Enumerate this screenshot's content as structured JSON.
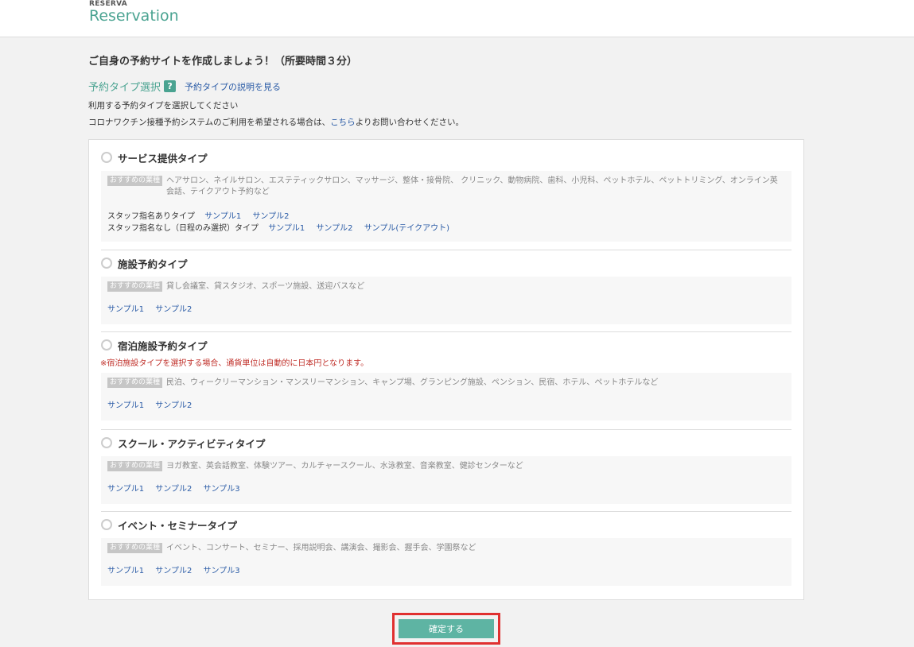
{
  "header": {
    "brand_small": "RESERVA",
    "brand_big": "Reservation"
  },
  "page": {
    "title": "ご自身の予約サイトを作成しましょう！（所要時間３分）",
    "section_title": "予約タイプ選択",
    "help_icon": "?",
    "help_link": "予約タイプの説明を見る",
    "intro1": "利用する予約タイプを選択してください",
    "intro2_before": "コロナワクチン接種予約システムのご利用を希望される場合は、",
    "intro2_link": "こちら",
    "intro2_after": "よりお問い合わせください。"
  },
  "badge_label": "おすすめの業種",
  "types": [
    {
      "name": "サービス提供タイプ",
      "recommend": "ヘアサロン、ネイルサロン、エステティックサロン、マッサージ、整体・接骨院、 クリニック、動物病院、歯科、小児科、ペットホテル、ペットトリミング、オンライン英会話、テイクアウト予約など",
      "sample_rows": [
        {
          "label": "スタッフ指名ありタイプ",
          "links": [
            "サンプル1",
            "サンプル2"
          ]
        },
        {
          "label": "スタッフ指名なし（日程のみ選択）タイプ",
          "links": [
            "サンプル1",
            "サンプル2",
            "サンプル(テイクアウト)"
          ]
        }
      ]
    },
    {
      "name": "施設予約タイプ",
      "recommend": "貸し会議室、貸スタジオ、スポーツ施設、送迎バスなど",
      "sample_rows": [
        {
          "label": "",
          "links": [
            "サンプル1",
            "サンプル2"
          ]
        }
      ]
    },
    {
      "name": "宿泊施設予約タイプ",
      "warning": "※宿泊施設タイプを選択する場合、通貨単位は自動的に日本円となります。",
      "recommend": "民泊、ウィークリーマンション・マンスリーマンション、キャンプ場、グランピング施設、ペンション、民宿、ホテル、ペットホテルなど",
      "sample_rows": [
        {
          "label": "",
          "links": [
            "サンプル1",
            "サンプル2"
          ]
        }
      ]
    },
    {
      "name": "スクール・アクティビティタイプ",
      "recommend": "ヨガ教室、英会話教室、体験ツアー、カルチャースクール、水泳教室、音楽教室、健診センターなど",
      "sample_rows": [
        {
          "label": "",
          "links": [
            "サンプル1",
            "サンプル2",
            "サンプル3"
          ]
        }
      ]
    },
    {
      "name": "イベント・セミナータイプ",
      "recommend": "イベント、コンサート、セミナー、採用説明会、講演会、撮影会、握手会、学園祭など",
      "sample_rows": [
        {
          "label": "",
          "links": [
            "サンプル1",
            "サンプル2",
            "サンプル3"
          ]
        }
      ]
    }
  ],
  "confirm_label": "確定する"
}
